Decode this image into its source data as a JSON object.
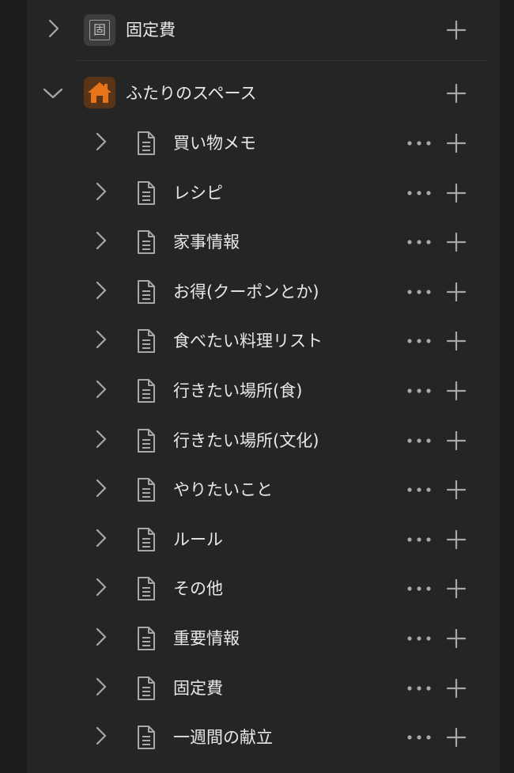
{
  "top_item": {
    "label": "固定費",
    "icon_char": "固",
    "icon": "document-box-icon"
  },
  "workspace": {
    "label": "ふたりのスペース",
    "icon": "house-icon",
    "icon_color": "#e8741a",
    "expanded": true
  },
  "pages": [
    {
      "label": "買い物メモ"
    },
    {
      "label": "レシピ"
    },
    {
      "label": "家事情報"
    },
    {
      "label": "お得(クーポンとか)"
    },
    {
      "label": "食べたい料理リスト"
    },
    {
      "label": "行きたい場所(食)"
    },
    {
      "label": "行きたい場所(文化)"
    },
    {
      "label": "やりたいこと"
    },
    {
      "label": "ルール"
    },
    {
      "label": "その他"
    },
    {
      "label": "重要情報"
    },
    {
      "label": "固定費"
    },
    {
      "label": "一週間の献立"
    }
  ],
  "colors": {
    "background": "#1c1c1c",
    "panel": "#252525",
    "icon_stroke": "#a8a8a8",
    "text": "#e8e8e8"
  }
}
